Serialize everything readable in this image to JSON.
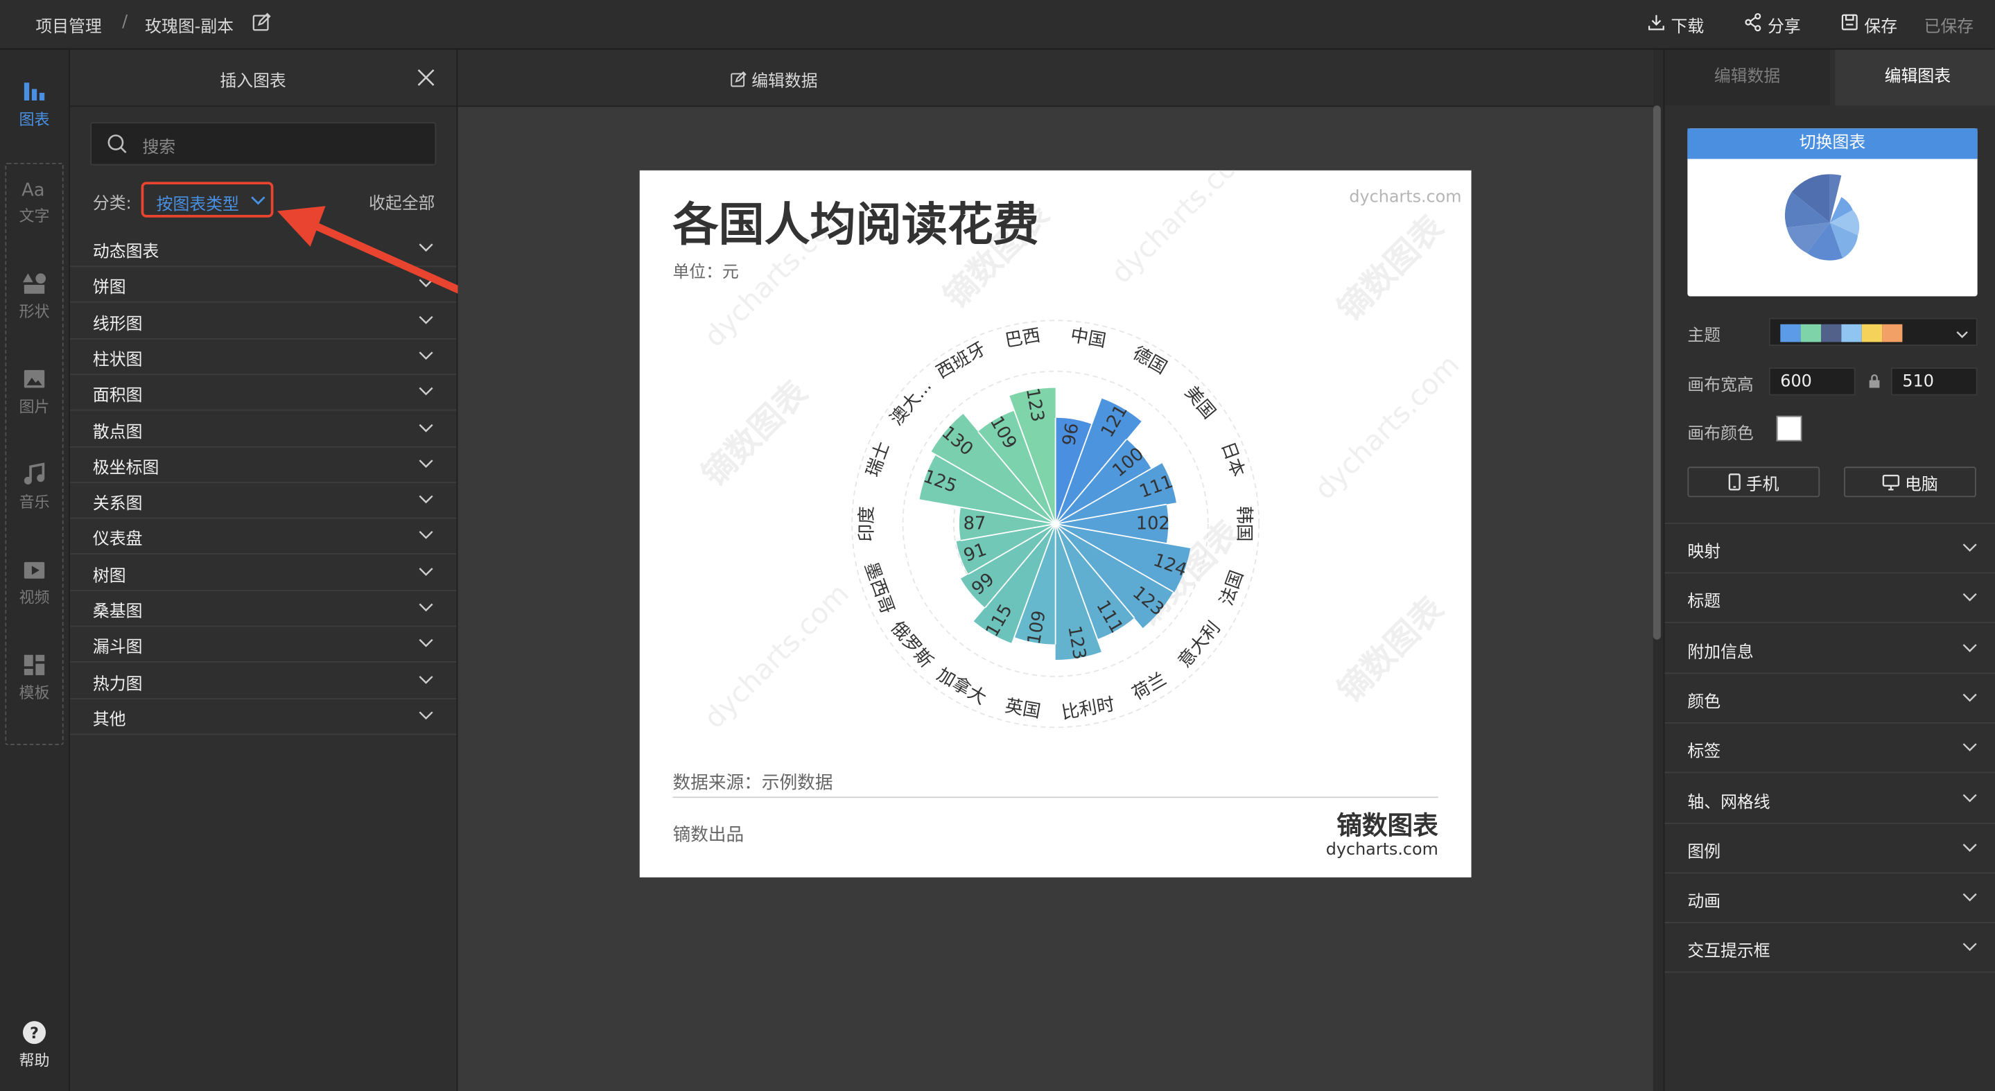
{
  "topbar": {
    "crumb_root": "项目管理",
    "crumb_sep": "/",
    "crumb_file": "玫瑰图-副本",
    "download": "下载",
    "share": "分享",
    "save": "保存",
    "saved_status": "已保存"
  },
  "rail": {
    "items": [
      {
        "label": "图表",
        "icon": "bar-chart-icon"
      },
      {
        "label": "文字",
        "icon": "text-icon"
      },
      {
        "label": "形状",
        "icon": "shapes-icon"
      },
      {
        "label": "图片",
        "icon": "image-icon"
      },
      {
        "label": "音乐",
        "icon": "music-icon"
      },
      {
        "label": "视频",
        "icon": "video-icon"
      },
      {
        "label": "模板",
        "icon": "template-icon"
      }
    ],
    "help": "帮助"
  },
  "panel": {
    "title": "插入图表",
    "search_placeholder": "搜索",
    "category_label": "分类:",
    "category_value": "按图表类型",
    "collapse_all": "收起全部",
    "categories": [
      "动态图表",
      "饼图",
      "线形图",
      "柱状图",
      "面积图",
      "散点图",
      "极坐标图",
      "关系图",
      "仪表盘",
      "树图",
      "桑基图",
      "漏斗图",
      "热力图",
      "其他"
    ]
  },
  "middle": {
    "edit_data": "编辑数据"
  },
  "chart": {
    "title": "各国人均阅读花费",
    "unit": "单位：元",
    "watermark_url": "dycharts.com",
    "watermark_cn": "镝数图表",
    "source": "数据来源：示例数据",
    "producer": "镝数出品",
    "brand_cn": "镝数图表",
    "brand_url": "dycharts.com"
  },
  "chart_data": {
    "type": "nightingale-rose",
    "categories": [
      "中国",
      "德国",
      "美国",
      "日本",
      "韩国",
      "法国",
      "意大利",
      "荷兰",
      "比利时",
      "英国",
      "加拿大",
      "俄罗斯",
      "墨西哥",
      "印度",
      "瑞士",
      "澳大...",
      "西班牙",
      "巴西"
    ],
    "values": [
      96,
      121,
      100,
      111,
      102,
      124,
      123,
      111,
      123,
      109,
      115,
      99,
      91,
      87,
      125,
      130,
      109,
      123
    ],
    "colors": {
      "blue_start": "#4a8fe0",
      "blue_end": "#66b8cc",
      "teal_start": "#6cc3bb",
      "green_end": "#7fd4a9"
    }
  },
  "right": {
    "tab_data": "编辑数据",
    "tab_chart": "编辑图表",
    "switch_chart": "切换图表",
    "theme_label": "主题",
    "theme_colors": [
      "#5b9be8",
      "#7fd3a9",
      "#51618a",
      "#8fc5f0",
      "#f5d35a",
      "#f2a065"
    ],
    "canvas_size_label": "画布宽高",
    "width": "600",
    "height": "510",
    "canvas_color_label": "画布颜色",
    "mobile": "手机",
    "desktop": "电脑",
    "sections": [
      "映射",
      "标题",
      "附加信息",
      "颜色",
      "标签",
      "轴、网格线",
      "图例",
      "动画",
      "交互提示框"
    ]
  },
  "annotation": {
    "highlight_color": "#e8442f"
  }
}
